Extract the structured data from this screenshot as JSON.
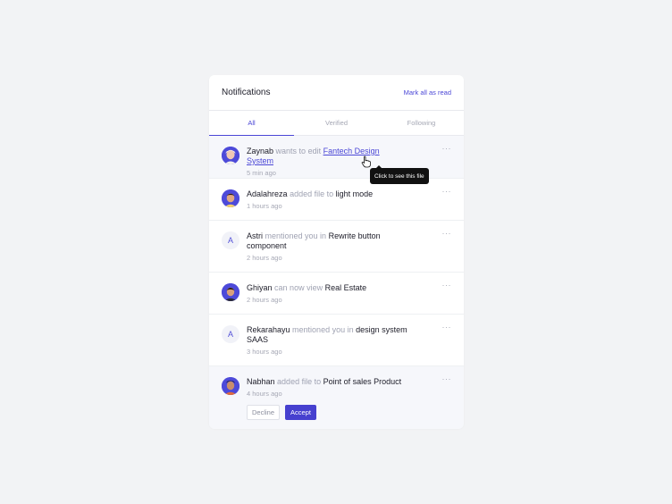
{
  "header": {
    "title": "Notifications",
    "mark_all_label": "Mark all as read"
  },
  "tabs": [
    {
      "label": "All",
      "active": true
    },
    {
      "label": "Verified",
      "active": false
    },
    {
      "label": "Following",
      "active": false
    }
  ],
  "notifications": [
    {
      "name": "Zaynab",
      "action": "wants to edit",
      "target": "Fantech Design System",
      "time": "5 min ago",
      "avatar": "photo"
    },
    {
      "name": "Adalahreza",
      "action": "added file to",
      "target": "light mode",
      "time": "1 hours ago",
      "avatar": "photo"
    },
    {
      "name": "Astri",
      "action": "mentioned you in",
      "target": "Rewrite button component",
      "time": "2 hours ago",
      "avatar": "letter",
      "initial": "A"
    },
    {
      "name": "Ghiyan",
      "action": "can now view",
      "target": "Real Estate",
      "time": "2 hours ago",
      "avatar": "photo"
    },
    {
      "name": "Rekarahayu",
      "action": "mentioned you in",
      "target": "design system SAAS",
      "time": "3 hours ago",
      "avatar": "letter",
      "initial": "A"
    },
    {
      "name": "Nabhan",
      "action": "added file to",
      "target": "Point of sales Product",
      "time": "4 hours ago",
      "avatar": "photo",
      "decline_label": "Decline",
      "accept_label": "Accept"
    }
  ],
  "more_label": "···",
  "tooltip": {
    "text": "Click to see this file"
  },
  "colors": {
    "accent": "#4b47d6",
    "page_bg": "#f2f3f5",
    "card_bg": "#ffffff",
    "highlight_bg": "#f6f7fb"
  }
}
